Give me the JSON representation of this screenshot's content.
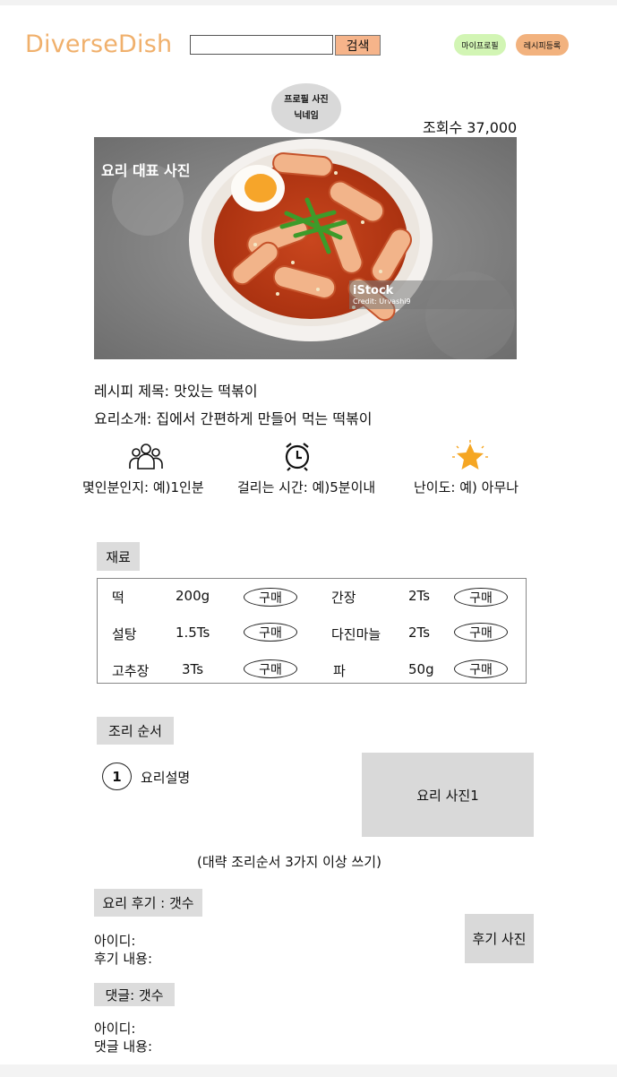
{
  "header": {
    "logo": "DiverseDish",
    "search_value": "",
    "search_button": "검색",
    "my_profile_button": "마이프로필",
    "register_recipe_button": "레시피등록"
  },
  "author": {
    "photo_label": "프로필 사진",
    "nickname": "닉네임"
  },
  "views": "조회수 37,000",
  "hero": {
    "label": "요리 대표 사진",
    "watermark_brand": "iStock",
    "watermark_credit": "Credit: Urvashi9"
  },
  "recipe": {
    "title": "레시피 제목: 맛있는 떡볶이",
    "intro": "요리소개: 집에서 간편하게 만들어 먹는 떡볶이"
  },
  "meta": {
    "servings": "몇인분인지: 예)1인분",
    "time": "걸리는 시간: 예)5분이내",
    "difficulty": "난이도: 예) 아무나",
    "icons": [
      "people-icon",
      "alarm-clock-icon",
      "star-icon"
    ],
    "star_color": "#f5a623"
  },
  "ingredients": {
    "heading": "재료",
    "buy_label": "구매",
    "items": [
      {
        "name": "떡",
        "amount": "200g"
      },
      {
        "name": "간장",
        "amount": "2Ts"
      },
      {
        "name": "설탕",
        "amount": "1.5Ts"
      },
      {
        "name": "다진마늘",
        "amount": "2Ts"
      },
      {
        "name": "고추장",
        "amount": "3Ts"
      },
      {
        "name": "파",
        "amount": "50g"
      }
    ]
  },
  "steps": {
    "heading": "조리 순서",
    "items": [
      {
        "number": "1",
        "description": "요리설명",
        "photo_label": "요리 사진1"
      }
    ],
    "note": "(대략 조리순서 3가지 이상 쓰기)"
  },
  "reviews": {
    "heading": "요리 후기 : 갯수",
    "id_label": "아이디:",
    "content_label": "후기 내용:",
    "photo_label": "후기 사진"
  },
  "comments": {
    "heading": "댓글: 갯수",
    "id_label": "아이디:",
    "content_label": "댓글 내용:"
  },
  "colors": {
    "logo": "#f0b06c",
    "search_button": "#f6b48a",
    "my_profile_pill": "#d2f5b4",
    "register_pill": "#f2b27e",
    "placeholder_gray": "#d9d9d9"
  }
}
